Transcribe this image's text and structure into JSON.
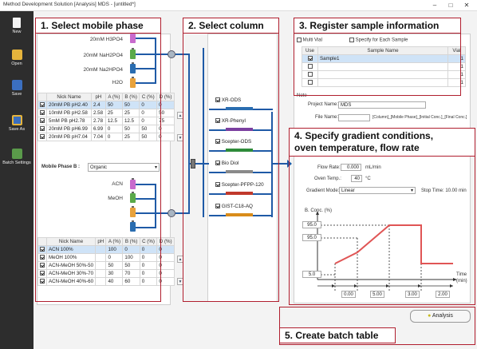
{
  "window": {
    "title": "Method Development Solution [Analysis] MDS - [untitled*]",
    "minimize": "–",
    "maximize": "□",
    "close": "✕"
  },
  "sidebar": {
    "items": [
      {
        "label": "New",
        "icon": "new-file-icon"
      },
      {
        "label": "Open",
        "icon": "open-folder-icon"
      },
      {
        "label": "Save",
        "icon": "save-icon"
      },
      {
        "label": "Save As",
        "icon": "save-as-icon"
      },
      {
        "label": "Batch Settings",
        "icon": "batch-settings-icon"
      }
    ]
  },
  "callouts": {
    "c1": "1.  Select mobile phase",
    "c2": "2.  Select column",
    "c3": "3.  Register sample information",
    "c4_line1": "4.  Specify gradient conditions,",
    "c4_line2": "oven temperature, flow rate",
    "c5": "5.  Create batch table"
  },
  "mobile_phase_a": {
    "bottles": [
      "20mM H3PO4",
      "20mM NaH2PO4",
      "20mM Na2HPO4",
      "H2O"
    ],
    "table_headers": [
      "",
      "Nick Name",
      "pH",
      "A (%)",
      "B (%)",
      "C (%)",
      "D (%)"
    ],
    "rows": [
      {
        "checked": true,
        "name": "20mM PB pH2.40",
        "ph": "2.4",
        "a": "50",
        "b": "50",
        "c": "0",
        "d": "0"
      },
      {
        "checked": true,
        "name": "10mM PB pH2.58",
        "ph": "2.58",
        "a": "25",
        "b": "25",
        "c": "0",
        "d": "50"
      },
      {
        "checked": true,
        "name": "5mM PB pH2.78",
        "ph": "2.78",
        "a": "12.5",
        "b": "12.5",
        "c": "0",
        "d": "75"
      },
      {
        "checked": true,
        "name": "20mM PB pH6.99",
        "ph": "6.99",
        "a": "0",
        "b": "50",
        "c": "50",
        "d": "0"
      },
      {
        "checked": true,
        "name": "20mM PB pH7.04",
        "ph": "7.04",
        "a": "0",
        "b": "25",
        "c": "50",
        "d": "0"
      }
    ]
  },
  "mobile_phase_b": {
    "label": "Mobile Phase B :",
    "selected": "Organic",
    "bottles": [
      "ACN",
      "MeOH",
      "",
      ""
    ],
    "table_headers": [
      "",
      "Nick Name",
      "pH",
      "A (%)",
      "B (%)",
      "C (%)",
      "D (%)"
    ],
    "rows": [
      {
        "checked": true,
        "name": "ACN 100%",
        "ph": "",
        "a": "100",
        "b": "0",
        "c": "0",
        "d": "0"
      },
      {
        "checked": true,
        "name": "MeOH 100%",
        "ph": "",
        "a": "0",
        "b": "100",
        "c": "0",
        "d": "0"
      },
      {
        "checked": true,
        "name": "ACN-MeOH 50%-50",
        "ph": "",
        "a": "50",
        "b": "50",
        "c": "0",
        "d": "0"
      },
      {
        "checked": true,
        "name": "ACN-MeOH 30%-70",
        "ph": "",
        "a": "30",
        "b": "70",
        "c": "0",
        "d": "0"
      },
      {
        "checked": true,
        "name": "ACN-MeOH 40%-60",
        "ph": "",
        "a": "40",
        "b": "60",
        "c": "0",
        "d": "0"
      }
    ]
  },
  "columns": [
    {
      "name": "XR-ODS",
      "checked": true,
      "color": "#2a6db0"
    },
    {
      "name": "XR-Phenyl",
      "checked": true,
      "color": "#7b3fa0"
    },
    {
      "name": "Scepter-ODS",
      "checked": true,
      "color": "#2e8b3a"
    },
    {
      "name": "Bio Diol",
      "checked": true,
      "color": "#8a8a8a"
    },
    {
      "name": "Scepter-PFPP-120",
      "checked": true,
      "color": "#c0392b"
    },
    {
      "name": "GIST-C18-AQ",
      "checked": true,
      "color": "#d98c1a"
    }
  ],
  "sample": {
    "multi_vial": "Multi Vial",
    "specify_each": "Specify for Each Sample",
    "headers": [
      "Use",
      "Sample Name",
      "Vial"
    ],
    "rows": [
      {
        "checked": true,
        "name": "Sample1",
        "vial": "1"
      },
      {
        "checked": false,
        "name": "",
        "vial": "1"
      },
      {
        "checked": false,
        "name": "",
        "vial": "1"
      },
      {
        "checked": false,
        "name": "",
        "vial": "1"
      }
    ],
    "note_label": "Note",
    "project_label": "Project Name:",
    "project_value": "MDS",
    "file_label": "File Name:",
    "file_value": "",
    "file_hint": "[Column]_[Mobile Phase]_[Initial Conc.]_[Final Conc.]"
  },
  "gradient": {
    "flow_label": "Flow Rate:",
    "flow_value": "0.000",
    "flow_unit": "mL/min",
    "oven_label": "Oven Temp.:",
    "oven_value": "40",
    "oven_unit": "°C",
    "mode_label": "Gradient Mode:",
    "mode_value": "Linear",
    "stop_time": "Stop Time: 10.00 min",
    "y_axis_label": "B. Conc. (%)",
    "x_axis_label_1": "Time",
    "x_axis_label_2": "(min)",
    "level_high_1": "95.0",
    "level_high_2": "95.0",
    "level_low": "5.0",
    "durations": [
      "0.00",
      "5.00",
      "3.00",
      "2.00"
    ]
  },
  "analysis_button": "Analysis",
  "colors": {
    "accent_red": "#b01e2e",
    "line_blue": "#1f5aa6",
    "gradient_red": "#e05555",
    "selection": "#cfe3f7"
  }
}
